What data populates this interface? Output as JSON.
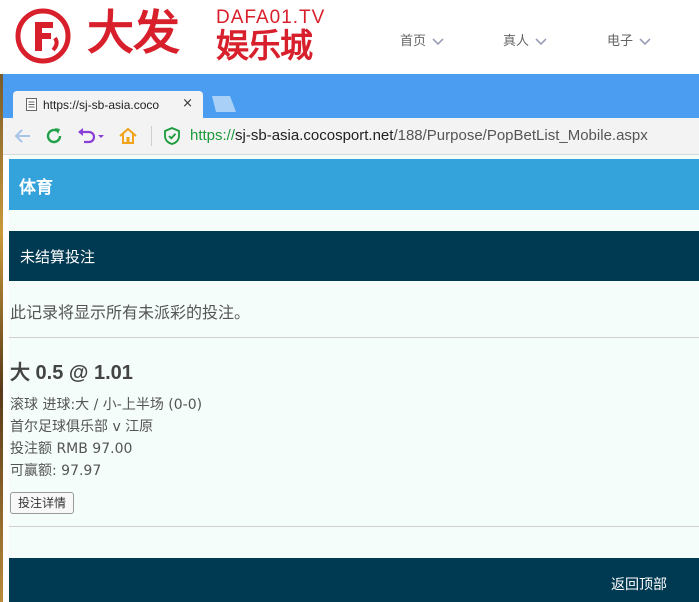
{
  "site": {
    "logo_text": "大发",
    "logo_domain": "DAFA01.TV",
    "logo_subtitle": "娱乐城",
    "nav": [
      {
        "label": "首页"
      },
      {
        "label": "真人"
      },
      {
        "label": "电子"
      }
    ],
    "brand_color": "#d8202c"
  },
  "browser": {
    "tab_title": "https://sj-sb-asia.coco",
    "tab_close": "×",
    "url": {
      "scheme": "https://",
      "host": "sj-sb-asia.cocosport.net",
      "path": "/188/Purpose/PopBetList_Mobile.aspx"
    },
    "icons": [
      "back-arrow-icon",
      "refresh-icon",
      "undo-icon",
      "home-icon",
      "security-shield-icon"
    ]
  },
  "page": {
    "section_title": "体育",
    "unsettled_title": "未结算投注",
    "description": "此记录将显示所有未派彩的投注。",
    "bet": {
      "headline": "大 0.5 @ 1.01",
      "market": "滚球 进球:大 / 小-上半场 (0-0)",
      "match": "首尔足球俱乐部 v 江原",
      "stake": "投注额 RMB 97.00",
      "payout": "可赢额: 97.97",
      "details_button": "投注详情"
    },
    "back_to_top": "返回顶部",
    "colors": {
      "section_bar": "#34a2db",
      "dark_bar": "#003a52",
      "background": "#f4fdf9"
    }
  }
}
